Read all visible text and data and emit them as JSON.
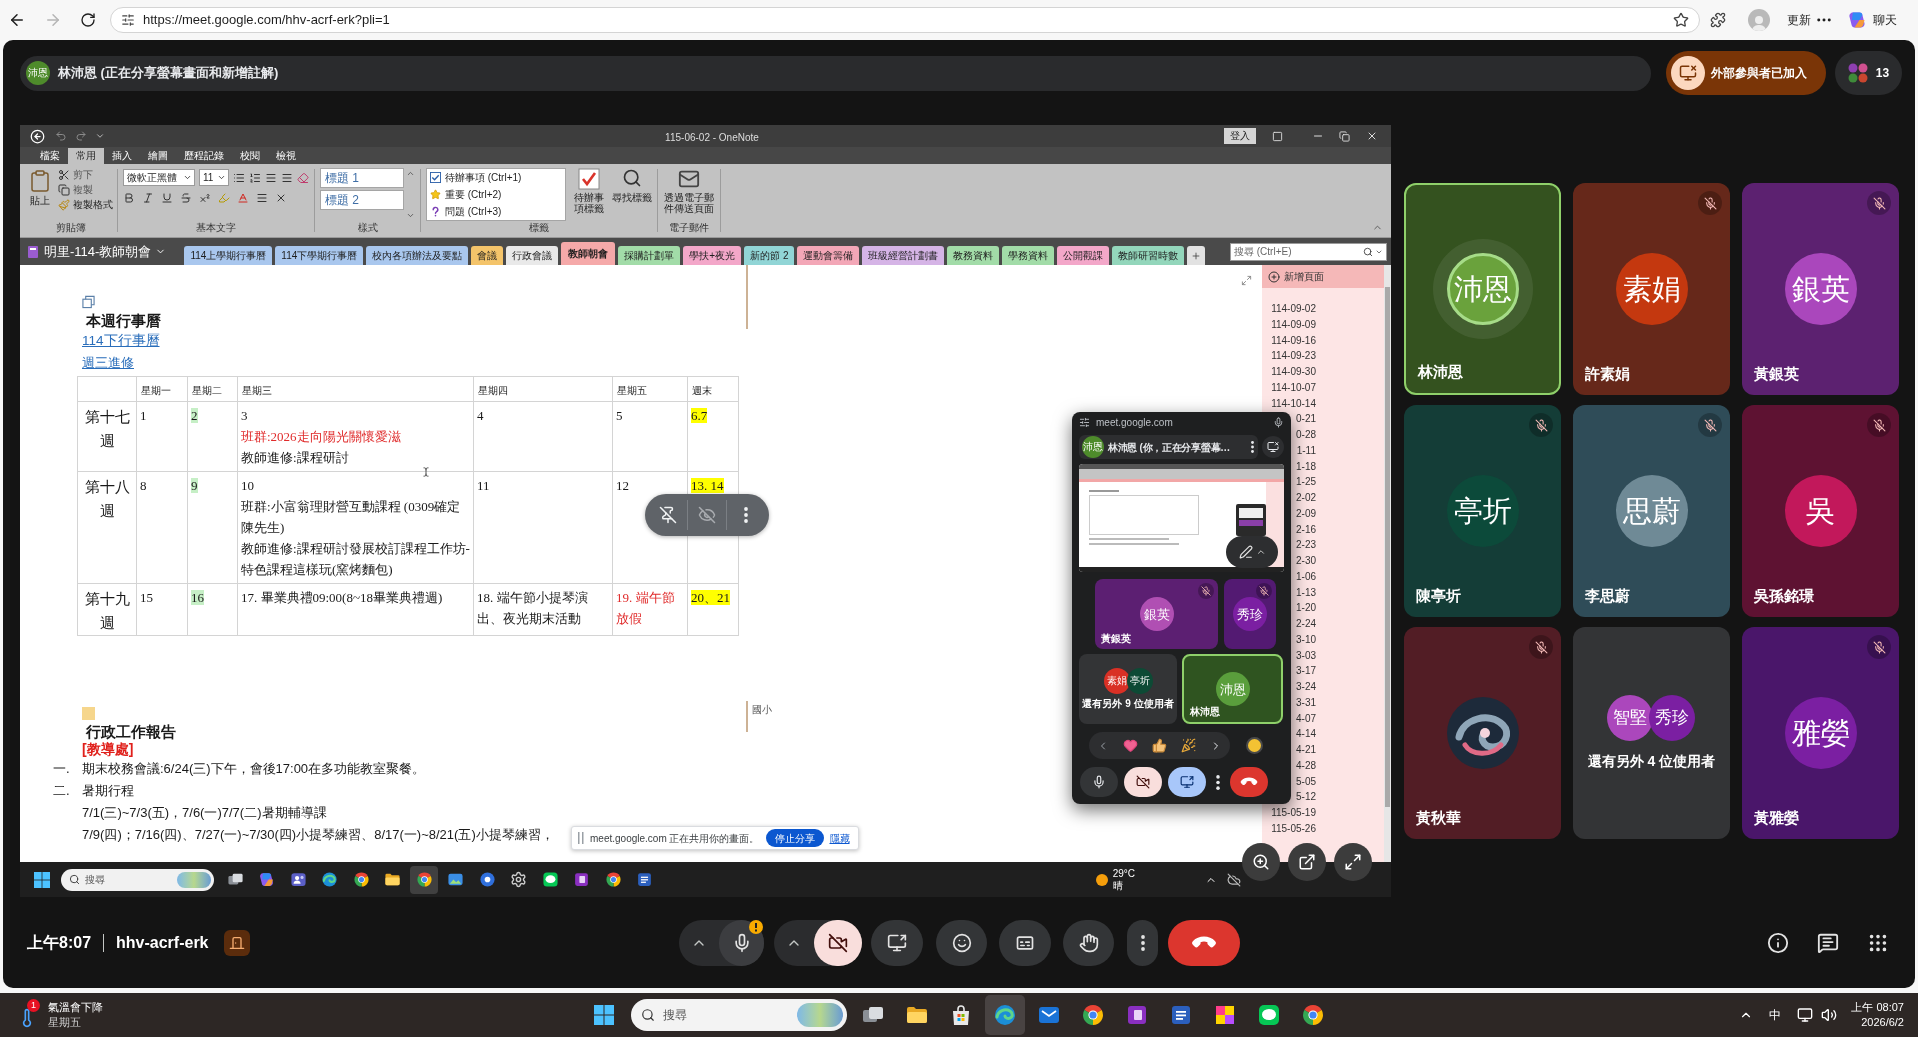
{
  "browser": {
    "url": "https://meet.google.com/hhv-acrf-erk?pli=1",
    "update_label": "更新",
    "chat_label": "聊天"
  },
  "meet_header": {
    "presenter_initials": "沛恩",
    "presenter_label": "林沛恩 (正在分享螢幕畫面和新增註解)",
    "external_notice": "外部參與者已加入",
    "participant_count": "13"
  },
  "onenote": {
    "title": "115-06-02 - OneNote",
    "sign_in": "登入",
    "tabs": [
      {
        "label": "檔案",
        "selected": false
      },
      {
        "label": "常用",
        "selected": true
      },
      {
        "label": "插入",
        "selected": false
      },
      {
        "label": "繪圖",
        "selected": false
      },
      {
        "label": "歷程記錄",
        "selected": false
      },
      {
        "label": "校閱",
        "selected": false
      },
      {
        "label": "檢視",
        "selected": false
      }
    ],
    "ribbon": {
      "clipboard": {
        "label": "剪貼簿",
        "paste": "貼上",
        "cut": "剪下",
        "copy": "複製",
        "format_painter": "複製格式"
      },
      "basic_text": {
        "label": "基本文字",
        "font": "微軟正黑體",
        "size": "11"
      },
      "styles": {
        "label": "樣式",
        "items": [
          "標題 1",
          "標題 2"
        ]
      },
      "tags": {
        "label": "標籤",
        "items": [
          {
            "kind": "todo",
            "label": "待辦事項 (Ctrl+1)"
          },
          {
            "kind": "important",
            "label": "重要 (Ctrl+2)"
          },
          {
            "kind": "question",
            "label": "問題 (Ctrl+3)"
          }
        ],
        "todo_tag": "待辦事項標籤",
        "find_tags": "尋找標籤"
      },
      "email": {
        "label": "電子郵件",
        "send": "透過電子郵件傳送頁面"
      }
    },
    "notebook": "明里-114-教師朝會",
    "sections": [
      {
        "label": "114上學期行事曆",
        "color": "#a9c7ee",
        "selected": false
      },
      {
        "label": "114下學期行事曆",
        "color": "#a9c7ee",
        "selected": false
      },
      {
        "label": "校內各項辦法及要點",
        "color": "#a9c7ee",
        "selected": false
      },
      {
        "label": "會議",
        "color": "#f4c46a",
        "selected": false
      },
      {
        "label": "行政會議",
        "color": "#e9e9e9",
        "selected": false
      },
      {
        "label": "教師朝會",
        "color": "#f5a9a9",
        "selected": true
      },
      {
        "label": "採購計劃單",
        "color": "#a2dca8",
        "selected": false
      },
      {
        "label": "學扶+夜光",
        "color": "#f3a7c9",
        "selected": false
      },
      {
        "label": "新的節 2",
        "color": "#91d5d6",
        "selected": false
      },
      {
        "label": "運動會籌備",
        "color": "#f3a7b7",
        "selected": false
      },
      {
        "label": "班級經營計劃書",
        "color": "#d5b4e6",
        "selected": false
      },
      {
        "label": "教務資料",
        "color": "#a2dca8",
        "selected": false
      },
      {
        "label": "學務資料",
        "color": "#a2dca8",
        "selected": false
      },
      {
        "label": "公開觀課",
        "color": "#f3a7c9",
        "selected": false
      },
      {
        "label": "教師研習時數",
        "color": "#93d6bb",
        "selected": false
      }
    ],
    "search_placeholder": "搜尋 (Ctrl+E)",
    "page": {
      "calendar_heading": "本週行事曆",
      "links": [
        "114下行事曆",
        "週三進修"
      ],
      "table": {
        "columns": [
          "星期一",
          "星期二",
          "星期三",
          "星期四",
          "星期五",
          "週末"
        ],
        "rows": [
          {
            "week": "第十七週",
            "cells": [
              {
                "lines": [
                  {
                    "text": "1"
                  }
                ]
              },
              {
                "lines": [
                  {
                    "text": "2"
                  }
                ],
                "highlight": {
                  "color": "#c6efc6"
                }
              },
              {
                "lines": [
                  {
                    "text": "3"
                  },
                  {
                    "text": "班群:2026走向陽光關懷愛滋",
                    "color": "#e02b2b"
                  },
                  {
                    "text": "教師進修:課程研討"
                  }
                ]
              },
              {
                "lines": [
                  {
                    "text": "4"
                  }
                ]
              },
              {
                "lines": [
                  {
                    "text": "5"
                  }
                ]
              },
              {
                "lines": [
                  {
                    "text": "6.7"
                  }
                ],
                "highlight": {
                  "color": "#ffff00"
                }
              }
            ]
          },
          {
            "week": "第十八週",
            "cells": [
              {
                "lines": [
                  {
                    "text": "8"
                  }
                ]
              },
              {
                "lines": [
                  {
                    "text": "9"
                  }
                ],
                "highlight": {
                  "color": "#c6efc6"
                }
              },
              {
                "lines": [
                  {
                    "text": "10"
                  },
                  {
                    "text": "班群:小富翁理財營互動課程 (0309確定陳先生)"
                  },
                  {
                    "text": "教師進修:課程研討發展校訂課程工作坊-特色課程這樣玩(窯烤麵包)"
                  }
                ]
              },
              {
                "lines": [
                  {
                    "text": "11"
                  }
                ]
              },
              {
                "lines": [
                  {
                    "text": "12"
                  }
                ]
              },
              {
                "lines": [
                  {
                    "text": "13. 14"
                  }
                ],
                "highlight": {
                  "color": "#ffff00"
                }
              }
            ]
          },
          {
            "week": "第十九週",
            "cells": [
              {
                "lines": [
                  {
                    "text": "15"
                  }
                ]
              },
              {
                "lines": [
                  {
                    "text": "16"
                  }
                ],
                "highlight": {
                  "color": "#c6efc6"
                }
              },
              {
                "lines": [
                  {
                    "text": "17. 畢業典禮09:00(8~18畢業典禮週)"
                  }
                ]
              },
              {
                "lines": [
                  {
                    "text": "18. 端午節小提琴演出、夜光期末活動"
                  }
                ]
              },
              {
                "lines": [
                  {
                    "text": "19. 端午節放假",
                    "color": "#e02b2b"
                  }
                ]
              },
              {
                "lines": [
                  {
                    "text": "20、21"
                  }
                ],
                "highlight": {
                  "color": "#ffff00"
                }
              }
            ]
          }
        ]
      },
      "report_heading": "行政工作報告",
      "office": "[教導處]",
      "items": [
        {
          "marker": "一.",
          "text": "期末校務會議:6/24(三)下午，會後17:00在多功能教室聚餐。"
        },
        {
          "marker": "二.",
          "text": "暑期行程",
          "children": [
            {
              "text": "7/1(三)~7/3(五)，7/6(一)7/7(二)暑期輔導課"
            },
            {
              "text": "7/9(四)；7/16(四)、7/27(一)~7/30(四)小提琴練習、8/17(一)~8/21(五)小提琴練習，"
            }
          ]
        }
      ],
      "side_note": "國小"
    },
    "page_list": {
      "add_label": "新增頁面",
      "pages": [
        "114-09-02",
        "114-09-09",
        "114-09-16",
        "114-09-23",
        "114-09-30",
        "114-10-07",
        "114-10-14",
        "0-21",
        "0-28",
        "1-11",
        "1-18",
        "1-25",
        "2-02",
        "2-09",
        "2-16",
        "2-23",
        "2-30",
        "1-06",
        "1-13",
        "1-20",
        "2-24",
        "3-10",
        "3-03",
        "3-17",
        "3-24",
        "3-31",
        "4-07",
        "4-14",
        "4-21",
        "4-28",
        "5-05",
        "5-12",
        "115-05-19",
        "115-05-26"
      ]
    }
  },
  "overlay_controls": [
    {
      "kind": "unpin",
      "disabled": false
    },
    {
      "kind": "hide",
      "disabled": true
    },
    {
      "kind": "more",
      "disabled": false
    }
  ],
  "share_notice": {
    "text": "meet.google.com 正在共用你的畫面。",
    "stop": "停止分享",
    "hide": "隱藏"
  },
  "pip": {
    "site": "meet.google.com",
    "presenter_initials": "沛恩",
    "presenter_label": "林沛恩 (你，正在分享螢幕…",
    "tiles": [
      {
        "kind": "person",
        "avatar": {
          "initials": "銀英",
          "color": "#b04fb3"
        },
        "name": "黃銀英",
        "color": "#5c1f72",
        "muted": true,
        "speaking": false
      },
      {
        "kind": "person",
        "avatar": {
          "initials": "秀珍",
          "color": "#7b1fa2"
        },
        "color": "#531a72",
        "muted": true,
        "speaking": false
      },
      {
        "kind": "others",
        "avatars": [
          {
            "initials": "素娟",
            "color": "#d93025"
          },
          {
            "initials": "亭圻",
            "color": "#0d4a35"
          }
        ],
        "label": "還有另外 9 位使用者",
        "color": "#333436",
        "muted": false,
        "speaking": false
      },
      {
        "kind": "person",
        "avatar": {
          "initials": "沛恩",
          "color": "#5a9e3c"
        },
        "name": "林沛恩",
        "color": "#2f5420",
        "muted": false,
        "speaking": true
      }
    ],
    "mic_on": true,
    "camera_on": false,
    "presenting": true
  },
  "inner_taskbar": {
    "search_placeholder": "搜尋",
    "apps": [
      {
        "kind": "stack",
        "active": false
      },
      {
        "kind": "swirl",
        "active": false
      },
      {
        "kind": "people",
        "active": false
      },
      {
        "kind": "wave",
        "active": false
      },
      {
        "kind": "ring",
        "active": false
      },
      {
        "kind": "folder",
        "active": false
      },
      {
        "kind": "ring",
        "active": true
      },
      {
        "kind": "picture",
        "active": false
      },
      {
        "kind": "disc",
        "active": false
      },
      {
        "kind": "gear",
        "active": false
      },
      {
        "kind": "bubble",
        "active": false
      },
      {
        "kind": "notebook",
        "active": false
      },
      {
        "kind": "ring",
        "active": false
      },
      {
        "kind": "document",
        "active": false
      }
    ],
    "temperature": "29°C",
    "condition": "晴"
  },
  "tiles": [
    {
      "kind": "person",
      "avatar": {
        "initials": "沛恩",
        "color": "#6aa23c"
      },
      "name": "林沛恩",
      "color": "#34521f",
      "muted": false,
      "speaking": true
    },
    {
      "kind": "person",
      "avatar": {
        "initials": "素娟",
        "color": "#c4380f"
      },
      "name": "許素娟",
      "color": "#66281a",
      "muted": true,
      "speaking": false
    },
    {
      "kind": "person",
      "avatar": {
        "initials": "銀英",
        "color": "#aa47bc"
      },
      "name": "黃銀英",
      "color": "#5c2170",
      "muted": true,
      "speaking": false
    },
    {
      "kind": "person",
      "avatar": {
        "initials": "亭圻",
        "color": "#0c4a3a"
      },
      "name": "陳亭圻",
      "color": "#143d37",
      "muted": true,
      "speaking": false
    },
    {
      "kind": "person",
      "avatar": {
        "initials": "思蔚",
        "color": "#6f8a96"
      },
      "name": "李思蔚",
      "color": "#2f4c58",
      "muted": true,
      "speaking": false
    },
    {
      "kind": "person",
      "avatar": {
        "initials": "吳",
        "color": "#c2185b"
      },
      "name": "吳孫銘璟",
      "color": "#5e1232",
      "muted": true,
      "speaking": false
    },
    {
      "kind": "photo",
      "name": "黃秋華",
      "color": "#521d25",
      "muted": true,
      "speaking": false
    },
    {
      "kind": "others",
      "avatars": [
        {
          "initials": "智堅",
          "color": "#ab47bc"
        },
        {
          "initials": "秀珍",
          "color": "#7b1fa2"
        }
      ],
      "label": "還有另外 4 位使用者",
      "color": "#333436",
      "muted": false,
      "speaking": false
    },
    {
      "kind": "person",
      "avatar": {
        "initials": "雅嫈",
        "color": "#7b1fa2"
      },
      "name": "黃雅嫈",
      "color": "#4a166a",
      "muted": true,
      "speaking": false
    }
  ],
  "bottom_bar": {
    "time": "上午8:07",
    "meeting_code": "hhv-acrf-erk",
    "mic_on": true,
    "mic_warning": true,
    "camera_on": false
  },
  "taskbar": {
    "weather_badge": "1",
    "weather_title": "氣溫會下降",
    "weather_day": "星期五",
    "search_placeholder": "搜尋",
    "apps": [
      {
        "kind": "stack",
        "active": false
      },
      {
        "kind": "folder",
        "active": false
      },
      {
        "kind": "bag",
        "active": false
      },
      {
        "kind": "wave",
        "active": true
      },
      {
        "kind": "envelope",
        "active": false
      },
      {
        "kind": "ring",
        "active": false
      },
      {
        "kind": "notebook",
        "active": false
      },
      {
        "kind": "document",
        "active": false
      },
      {
        "kind": "pinwheel",
        "active": false
      },
      {
        "kind": "bubble",
        "active": false
      },
      {
        "kind": "ring",
        "active": false
      }
    ],
    "ime": "中",
    "time": "上午 08:07",
    "date": "2026/6/2"
  }
}
